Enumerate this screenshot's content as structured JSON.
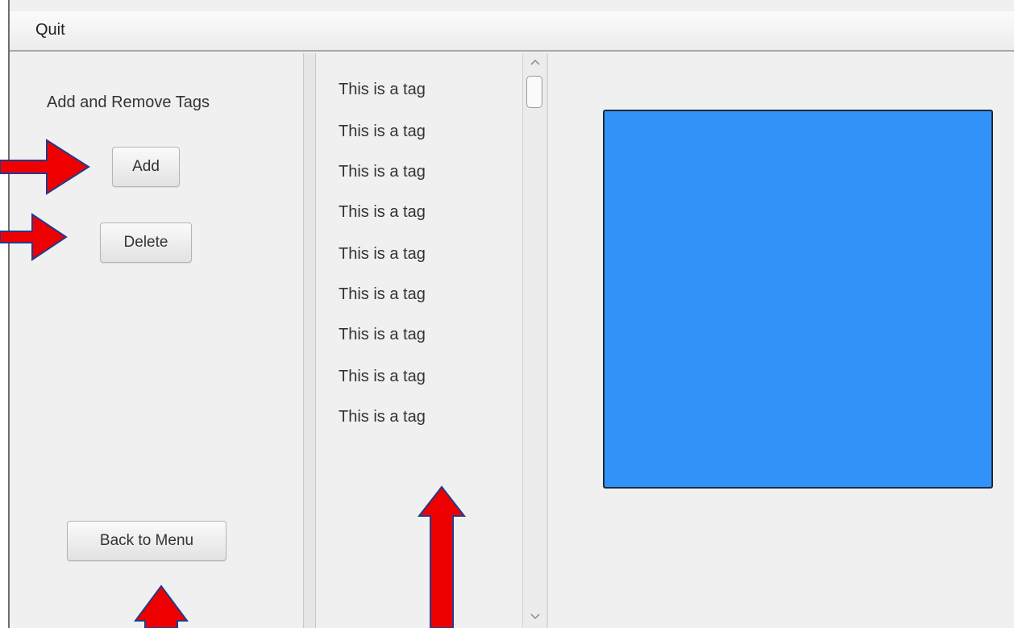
{
  "menubar": {
    "items": [
      {
        "label": "Quit"
      }
    ]
  },
  "left_panel": {
    "title": "Add and Remove Tags",
    "add_label": "Add",
    "delete_label": "Delete",
    "back_label": "Back to Menu"
  },
  "tags": {
    "items": [
      {
        "label": "This is a tag"
      },
      {
        "label": "This is a tag"
      },
      {
        "label": "This is a tag"
      },
      {
        "label": "This is a tag"
      },
      {
        "label": "This is a tag"
      },
      {
        "label": "This is a tag"
      },
      {
        "label": "This is a tag"
      },
      {
        "label": "This is a tag"
      },
      {
        "label": "This is a tag"
      }
    ]
  },
  "scrollbar": {
    "up_icon": "chevron-up-icon",
    "down_icon": "chevron-down-icon"
  },
  "preview": {
    "fill_color": "#3193fa"
  },
  "annotations": {
    "arrow_color": "#ee0000",
    "arrow_outline_color": "#1f3b8c"
  }
}
